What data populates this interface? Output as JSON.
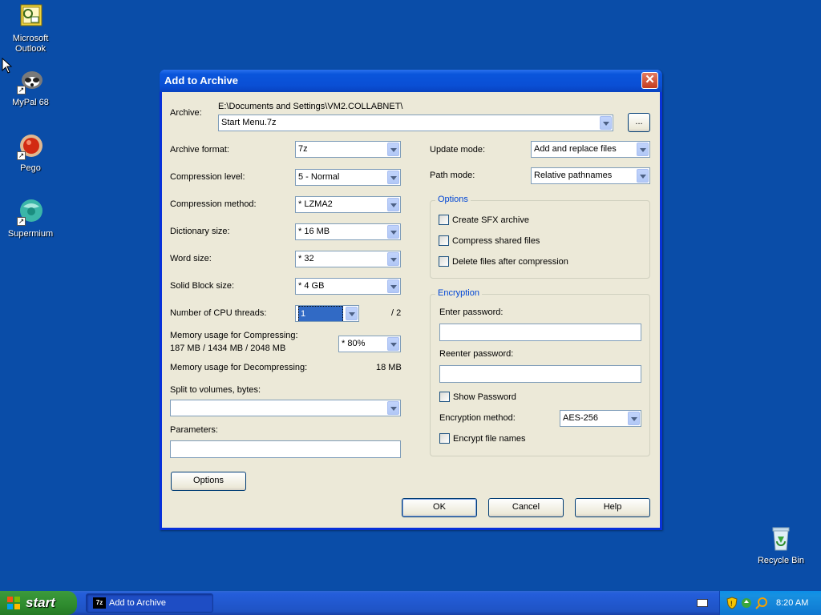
{
  "desktop": {
    "icons": [
      {
        "label_line1": "Microsoft",
        "label_line2": "Outlook"
      },
      {
        "label_line1": "MyPal 68",
        "label_line2": ""
      },
      {
        "label_line1": "Pego",
        "label_line2": ""
      },
      {
        "label_line1": "Supermium",
        "label_line2": ""
      },
      {
        "label_line1": "Recycle Bin",
        "label_line2": ""
      }
    ]
  },
  "dialog": {
    "title": "Add to Archive",
    "close_glyph": "✕",
    "archive_label": "Archive:",
    "archive_path": "E:\\Documents and Settings\\VM2.COLLABNET\\",
    "archive_name": "Start Menu.7z",
    "browse_label": "...",
    "left": {
      "archive_format_label": "Archive format:",
      "archive_format_value": "7z",
      "compression_level_label": "Compression level:",
      "compression_level_value": "5 - Normal",
      "compression_method_label": "Compression method:",
      "compression_method_value": "*  LZMA2",
      "dictionary_size_label": "Dictionary size:",
      "dictionary_size_value": "*  16 MB",
      "word_size_label": "Word size:",
      "word_size_value": "*  32",
      "solid_block_label": "Solid Block size:",
      "solid_block_value": "*  4 GB",
      "cpu_threads_label": "Number of CPU threads:",
      "cpu_threads_value": "1",
      "cpu_threads_total": "/ 2",
      "mem_compress_label": "Memory usage for Compressing:",
      "mem_compress_value": "187 MB / 1434 MB / 2048 MB",
      "mem_compress_percent": "* 80%",
      "mem_decompress_label": "Memory usage for Decompressing:",
      "mem_decompress_value": "18 MB",
      "split_label": "Split to volumes, bytes:",
      "split_value": "",
      "parameters_label": "Parameters:",
      "parameters_value": "",
      "options_button": "Options"
    },
    "right": {
      "update_mode_label": "Update mode:",
      "update_mode_value": "Add and replace files",
      "path_mode_label": "Path mode:",
      "path_mode_value": "Relative pathnames",
      "options_group_title": "Options",
      "create_sfx_label": "Create SFX archive",
      "compress_shared_label": "Compress shared files",
      "delete_after_label": "Delete files after compression",
      "encryption_group_title": "Encryption",
      "enter_password_label": "Enter password:",
      "reenter_password_label": "Reenter password:",
      "show_password_label": "Show Password",
      "encryption_method_label": "Encryption method:",
      "encryption_method_value": "AES-256",
      "encrypt_names_label": "Encrypt file names"
    },
    "buttons": {
      "ok": "OK",
      "cancel": "Cancel",
      "help": "Help"
    }
  },
  "taskbar": {
    "start_label": "start",
    "task_label": "Add to Archive",
    "task_icon_text": "7z",
    "clock": "8:20 AM"
  },
  "colors": {
    "desktop": "#0a4da8",
    "titlebar": "#0a55db",
    "dialog_bg": "#ece9d8",
    "group_title": "#0046d5",
    "selection": "#316ac5"
  }
}
